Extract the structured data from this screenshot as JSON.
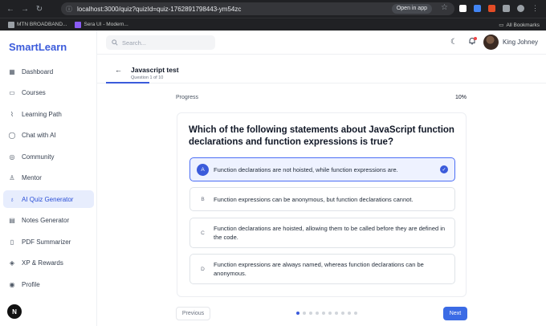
{
  "browser": {
    "url": "localhost:3000/quiz?quizId=quiz-1762891798443-ym54zc",
    "open_in_app": "Open in app",
    "bookmarks": [
      "MTN BROADBAND...",
      "Sera UI - Modern..."
    ],
    "all_bookmarks": "All Bookmarks"
  },
  "app": {
    "logo": "SmartLearn"
  },
  "sidebar": {
    "items": [
      {
        "label": "Dashboard",
        "icon": "dashboard-icon"
      },
      {
        "label": "Courses",
        "icon": "book-icon"
      },
      {
        "label": "Learning Path",
        "icon": "path-icon"
      },
      {
        "label": "Chat with AI",
        "icon": "chat-icon"
      },
      {
        "label": "Community",
        "icon": "community-icon"
      },
      {
        "label": "Mentor",
        "icon": "mentor-icon"
      },
      {
        "label": "AI Quiz Generator",
        "icon": "lightbulb-icon",
        "active": true
      },
      {
        "label": "Notes Generator",
        "icon": "notes-icon"
      },
      {
        "label": "PDF Summarizer",
        "icon": "pdf-icon"
      },
      {
        "label": "XP & Rewards",
        "icon": "rewards-icon"
      },
      {
        "label": "Profile",
        "icon": "profile-icon"
      }
    ],
    "avatar_letter": "N"
  },
  "topbar": {
    "search_placeholder": "Search...",
    "user_name": "King Johney"
  },
  "quiz": {
    "title": "Javascript test",
    "subtitle": "Question 1 of 10",
    "progress_label": "Progress",
    "progress_value": "10%",
    "progress_fraction": 0.1,
    "question": "Which of the following statements about JavaScript function declarations and function expressions is true?",
    "options": [
      {
        "letter": "A",
        "text": "Function declarations are not hoisted, while function expressions are.",
        "selected": true
      },
      {
        "letter": "B",
        "text": "Function expressions can be anonymous, but function declarations cannot.",
        "selected": false
      },
      {
        "letter": "C",
        "text": "Function declarations are hoisted, allowing them to be called before they are defined in the code.",
        "selected": false
      },
      {
        "letter": "D",
        "text": "Function expressions are always named, whereas function declarations can be anonymous.",
        "selected": false
      }
    ],
    "prev_label": "Previous",
    "next_label": "Next",
    "total_questions": 10,
    "current_question": 1
  },
  "colors": {
    "brand": "#3b5bdb",
    "active_bg": "#e7edfd",
    "next_button": "#3b6be5"
  }
}
